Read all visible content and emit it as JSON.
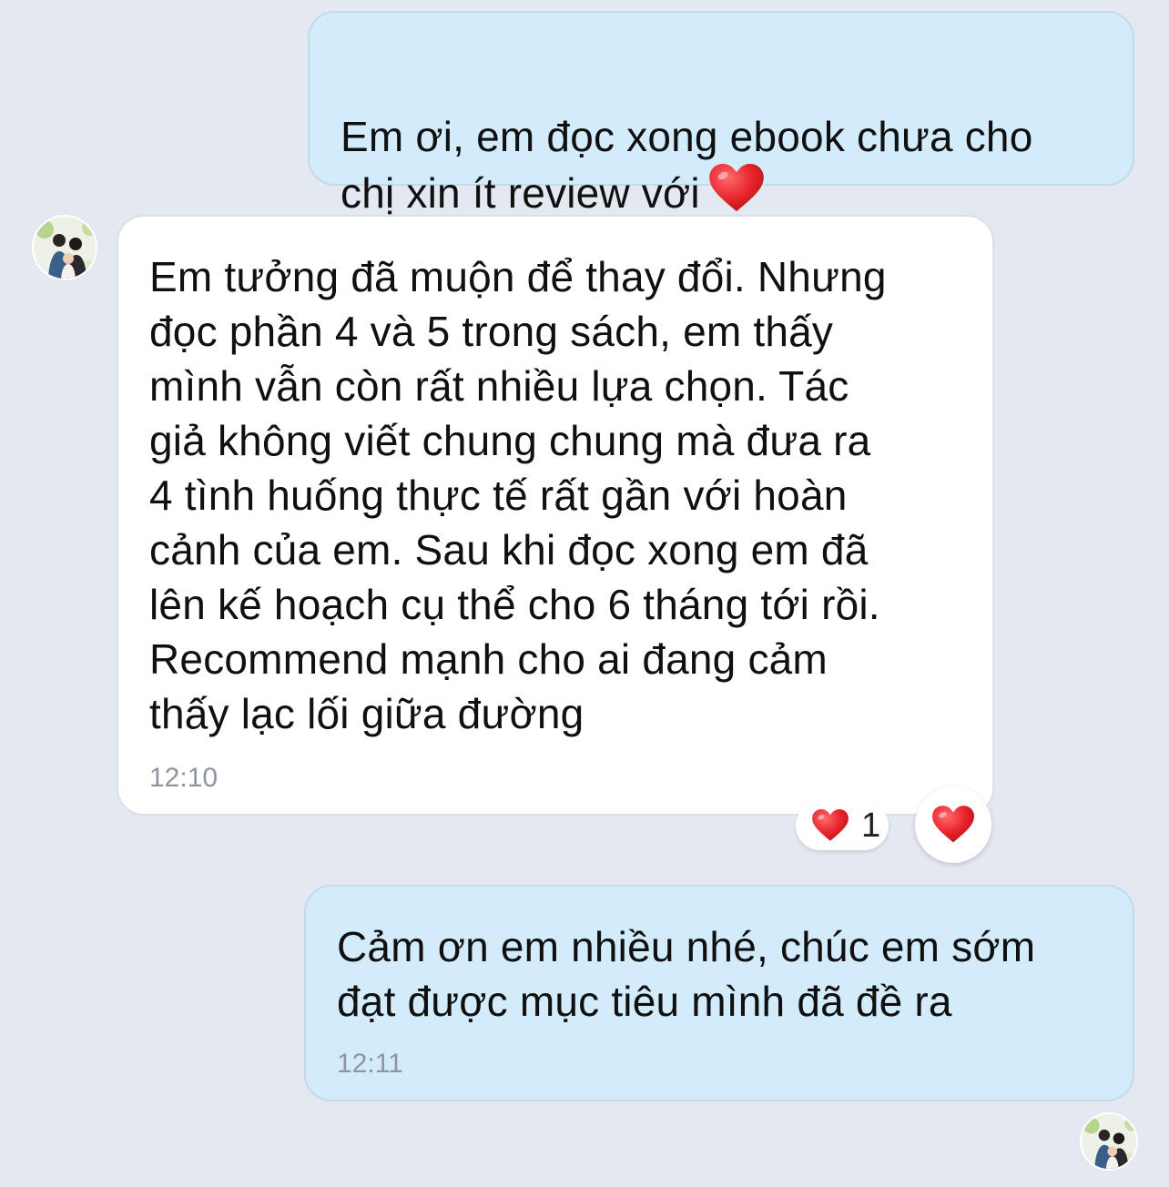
{
  "conversation": {
    "messages": [
      {
        "direction": "outgoing",
        "text": "Em ơi, em đọc xong ebook chưa cho\nchị xin ít review với",
        "emoji": "heart-icon"
      },
      {
        "direction": "incoming",
        "text": "Em tưởng đã muộn để thay đổi. Nhưng\nđọc phần 4 và 5 trong sách, em thấy\nmình vẫn còn rất nhiều lựa chọn. Tác\ngiả không viết chung chung mà đưa ra\n4 tình huống thực tế rất gần với hoàn\ncảnh của em. Sau khi đọc xong em đã\nlên kế hoạch cụ thể cho 6 tháng tới rồi.\nRecommend mạnh cho ai đang cảm\nthấy lạc lối giữa đường",
        "time": "12:10",
        "reaction": {
          "icon": "heart-icon",
          "count": "1"
        }
      },
      {
        "direction": "outgoing",
        "text": "Cảm ơn em nhiều nhé, chúc em sớm\nđạt được mục tiêu mình đã đề ra",
        "time": "12:11"
      }
    ],
    "react_button_icon": "heart-icon"
  },
  "colors": {
    "background": "#e4e8f1",
    "outgoing_bubble": "#d3ecfc",
    "incoming_bubble": "#ffffff",
    "heart": "#e8232b",
    "timestamp": "#8e959f"
  }
}
